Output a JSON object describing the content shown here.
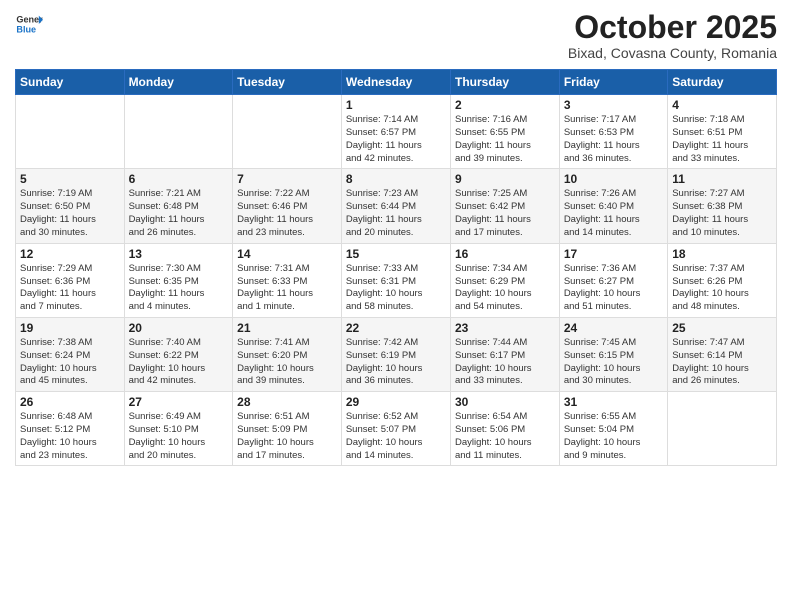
{
  "logo": {
    "general": "General",
    "blue": "Blue"
  },
  "header": {
    "month": "October 2025",
    "location": "Bixad, Covasna County, Romania"
  },
  "weekdays": [
    "Sunday",
    "Monday",
    "Tuesday",
    "Wednesday",
    "Thursday",
    "Friday",
    "Saturday"
  ],
  "weeks": [
    [
      {
        "day": "",
        "info": ""
      },
      {
        "day": "",
        "info": ""
      },
      {
        "day": "",
        "info": ""
      },
      {
        "day": "1",
        "info": "Sunrise: 7:14 AM\nSunset: 6:57 PM\nDaylight: 11 hours\nand 42 minutes."
      },
      {
        "day": "2",
        "info": "Sunrise: 7:16 AM\nSunset: 6:55 PM\nDaylight: 11 hours\nand 39 minutes."
      },
      {
        "day": "3",
        "info": "Sunrise: 7:17 AM\nSunset: 6:53 PM\nDaylight: 11 hours\nand 36 minutes."
      },
      {
        "day": "4",
        "info": "Sunrise: 7:18 AM\nSunset: 6:51 PM\nDaylight: 11 hours\nand 33 minutes."
      }
    ],
    [
      {
        "day": "5",
        "info": "Sunrise: 7:19 AM\nSunset: 6:50 PM\nDaylight: 11 hours\nand 30 minutes."
      },
      {
        "day": "6",
        "info": "Sunrise: 7:21 AM\nSunset: 6:48 PM\nDaylight: 11 hours\nand 26 minutes."
      },
      {
        "day": "7",
        "info": "Sunrise: 7:22 AM\nSunset: 6:46 PM\nDaylight: 11 hours\nand 23 minutes."
      },
      {
        "day": "8",
        "info": "Sunrise: 7:23 AM\nSunset: 6:44 PM\nDaylight: 11 hours\nand 20 minutes."
      },
      {
        "day": "9",
        "info": "Sunrise: 7:25 AM\nSunset: 6:42 PM\nDaylight: 11 hours\nand 17 minutes."
      },
      {
        "day": "10",
        "info": "Sunrise: 7:26 AM\nSunset: 6:40 PM\nDaylight: 11 hours\nand 14 minutes."
      },
      {
        "day": "11",
        "info": "Sunrise: 7:27 AM\nSunset: 6:38 PM\nDaylight: 11 hours\nand 10 minutes."
      }
    ],
    [
      {
        "day": "12",
        "info": "Sunrise: 7:29 AM\nSunset: 6:36 PM\nDaylight: 11 hours\nand 7 minutes."
      },
      {
        "day": "13",
        "info": "Sunrise: 7:30 AM\nSunset: 6:35 PM\nDaylight: 11 hours\nand 4 minutes."
      },
      {
        "day": "14",
        "info": "Sunrise: 7:31 AM\nSunset: 6:33 PM\nDaylight: 11 hours\nand 1 minute."
      },
      {
        "day": "15",
        "info": "Sunrise: 7:33 AM\nSunset: 6:31 PM\nDaylight: 10 hours\nand 58 minutes."
      },
      {
        "day": "16",
        "info": "Sunrise: 7:34 AM\nSunset: 6:29 PM\nDaylight: 10 hours\nand 54 minutes."
      },
      {
        "day": "17",
        "info": "Sunrise: 7:36 AM\nSunset: 6:27 PM\nDaylight: 10 hours\nand 51 minutes."
      },
      {
        "day": "18",
        "info": "Sunrise: 7:37 AM\nSunset: 6:26 PM\nDaylight: 10 hours\nand 48 minutes."
      }
    ],
    [
      {
        "day": "19",
        "info": "Sunrise: 7:38 AM\nSunset: 6:24 PM\nDaylight: 10 hours\nand 45 minutes."
      },
      {
        "day": "20",
        "info": "Sunrise: 7:40 AM\nSunset: 6:22 PM\nDaylight: 10 hours\nand 42 minutes."
      },
      {
        "day": "21",
        "info": "Sunrise: 7:41 AM\nSunset: 6:20 PM\nDaylight: 10 hours\nand 39 minutes."
      },
      {
        "day": "22",
        "info": "Sunrise: 7:42 AM\nSunset: 6:19 PM\nDaylight: 10 hours\nand 36 minutes."
      },
      {
        "day": "23",
        "info": "Sunrise: 7:44 AM\nSunset: 6:17 PM\nDaylight: 10 hours\nand 33 minutes."
      },
      {
        "day": "24",
        "info": "Sunrise: 7:45 AM\nSunset: 6:15 PM\nDaylight: 10 hours\nand 30 minutes."
      },
      {
        "day": "25",
        "info": "Sunrise: 7:47 AM\nSunset: 6:14 PM\nDaylight: 10 hours\nand 26 minutes."
      }
    ],
    [
      {
        "day": "26",
        "info": "Sunrise: 6:48 AM\nSunset: 5:12 PM\nDaylight: 10 hours\nand 23 minutes."
      },
      {
        "day": "27",
        "info": "Sunrise: 6:49 AM\nSunset: 5:10 PM\nDaylight: 10 hours\nand 20 minutes."
      },
      {
        "day": "28",
        "info": "Sunrise: 6:51 AM\nSunset: 5:09 PM\nDaylight: 10 hours\nand 17 minutes."
      },
      {
        "day": "29",
        "info": "Sunrise: 6:52 AM\nSunset: 5:07 PM\nDaylight: 10 hours\nand 14 minutes."
      },
      {
        "day": "30",
        "info": "Sunrise: 6:54 AM\nSunset: 5:06 PM\nDaylight: 10 hours\nand 11 minutes."
      },
      {
        "day": "31",
        "info": "Sunrise: 6:55 AM\nSunset: 5:04 PM\nDaylight: 10 hours\nand 9 minutes."
      },
      {
        "day": "",
        "info": ""
      }
    ]
  ]
}
